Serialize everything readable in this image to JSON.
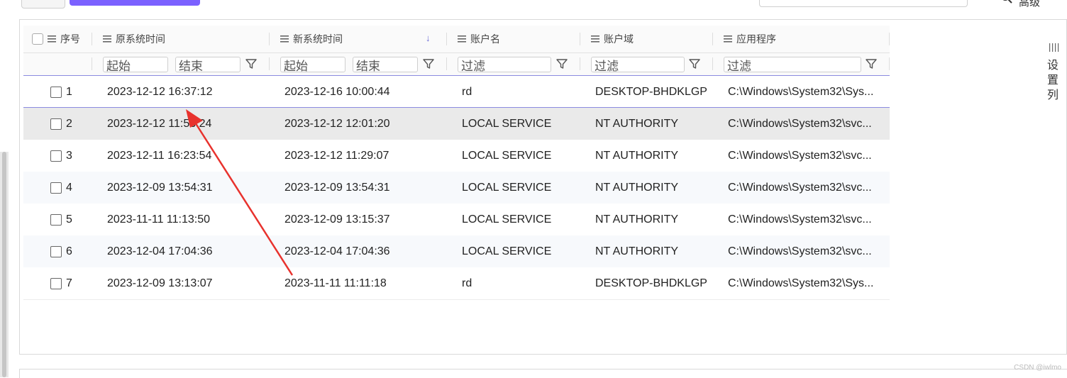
{
  "toolbar": {
    "search_icon": "search-icon",
    "search_label": "高级"
  },
  "table": {
    "select_all_icon": "checkbox-icon",
    "columns": [
      {
        "key": "seq",
        "label": "序号",
        "menu_icon": "list-icon"
      },
      {
        "key": "orig_time",
        "label": "原系统时间",
        "menu_icon": "list-icon"
      },
      {
        "key": "new_time",
        "label": "新系统时间",
        "menu_icon": "list-icon",
        "sort": "desc"
      },
      {
        "key": "account",
        "label": "账户名",
        "menu_icon": "list-icon"
      },
      {
        "key": "domain",
        "label": "账户域",
        "menu_icon": "list-icon"
      },
      {
        "key": "app",
        "label": "应用程序",
        "menu_icon": "list-icon"
      }
    ],
    "sort_indicator": "↓",
    "filters": {
      "orig_start": "起始",
      "orig_end": "结束",
      "new_start": "起始",
      "new_end": "结束",
      "account": "过滤",
      "domain": "过滤",
      "app": "过滤"
    },
    "rows": [
      {
        "seq": "1",
        "orig_time": "2023-12-12 16:37:12",
        "new_time": "2023-12-16 10:00:44",
        "account": "rd",
        "domain": "DESKTOP-BHDKLGP",
        "app": "C:\\Windows\\System32\\Sys..."
      },
      {
        "seq": "2",
        "orig_time": "2023-12-12 11:53:24",
        "new_time": "2023-12-12 12:01:20",
        "account": "LOCAL SERVICE",
        "domain": "NT AUTHORITY",
        "app": "C:\\Windows\\System32\\svc..."
      },
      {
        "seq": "3",
        "orig_time": "2023-12-11 16:23:54",
        "new_time": "2023-12-12 11:29:07",
        "account": "LOCAL SERVICE",
        "domain": "NT AUTHORITY",
        "app": "C:\\Windows\\System32\\svc..."
      },
      {
        "seq": "4",
        "orig_time": "2023-12-09 13:54:31",
        "new_time": "2023-12-09 13:54:31",
        "account": "LOCAL SERVICE",
        "domain": "NT AUTHORITY",
        "app": "C:\\Windows\\System32\\svc..."
      },
      {
        "seq": "5",
        "orig_time": "2023-11-11 11:13:50",
        "new_time": "2023-12-09 13:15:37",
        "account": "LOCAL SERVICE",
        "domain": "NT AUTHORITY",
        "app": "C:\\Windows\\System32\\svc..."
      },
      {
        "seq": "6",
        "orig_time": "2023-12-04 17:04:36",
        "new_time": "2023-12-04 17:04:36",
        "account": "LOCAL SERVICE",
        "domain": "NT AUTHORITY",
        "app": "C:\\Windows\\System32\\svc..."
      },
      {
        "seq": "7",
        "orig_time": "2023-12-09 13:13:07",
        "new_time": "2023-11-11 11:11:18",
        "account": "rd",
        "domain": "DESKTOP-BHDKLGP",
        "app": "C:\\Windows\\System32\\Sys..."
      }
    ]
  },
  "side_panel": {
    "label": "设置列",
    "chars": [
      "设",
      "置",
      "列"
    ],
    "icon": "columns-icon"
  },
  "annotation": {
    "arrow_color": "#e8322d"
  },
  "colors": {
    "accent": "#7b61ff",
    "selected_row": "#eaeaea",
    "sort_arrow": "#6b6bd6"
  },
  "watermark": "CSDN @iwlmo"
}
